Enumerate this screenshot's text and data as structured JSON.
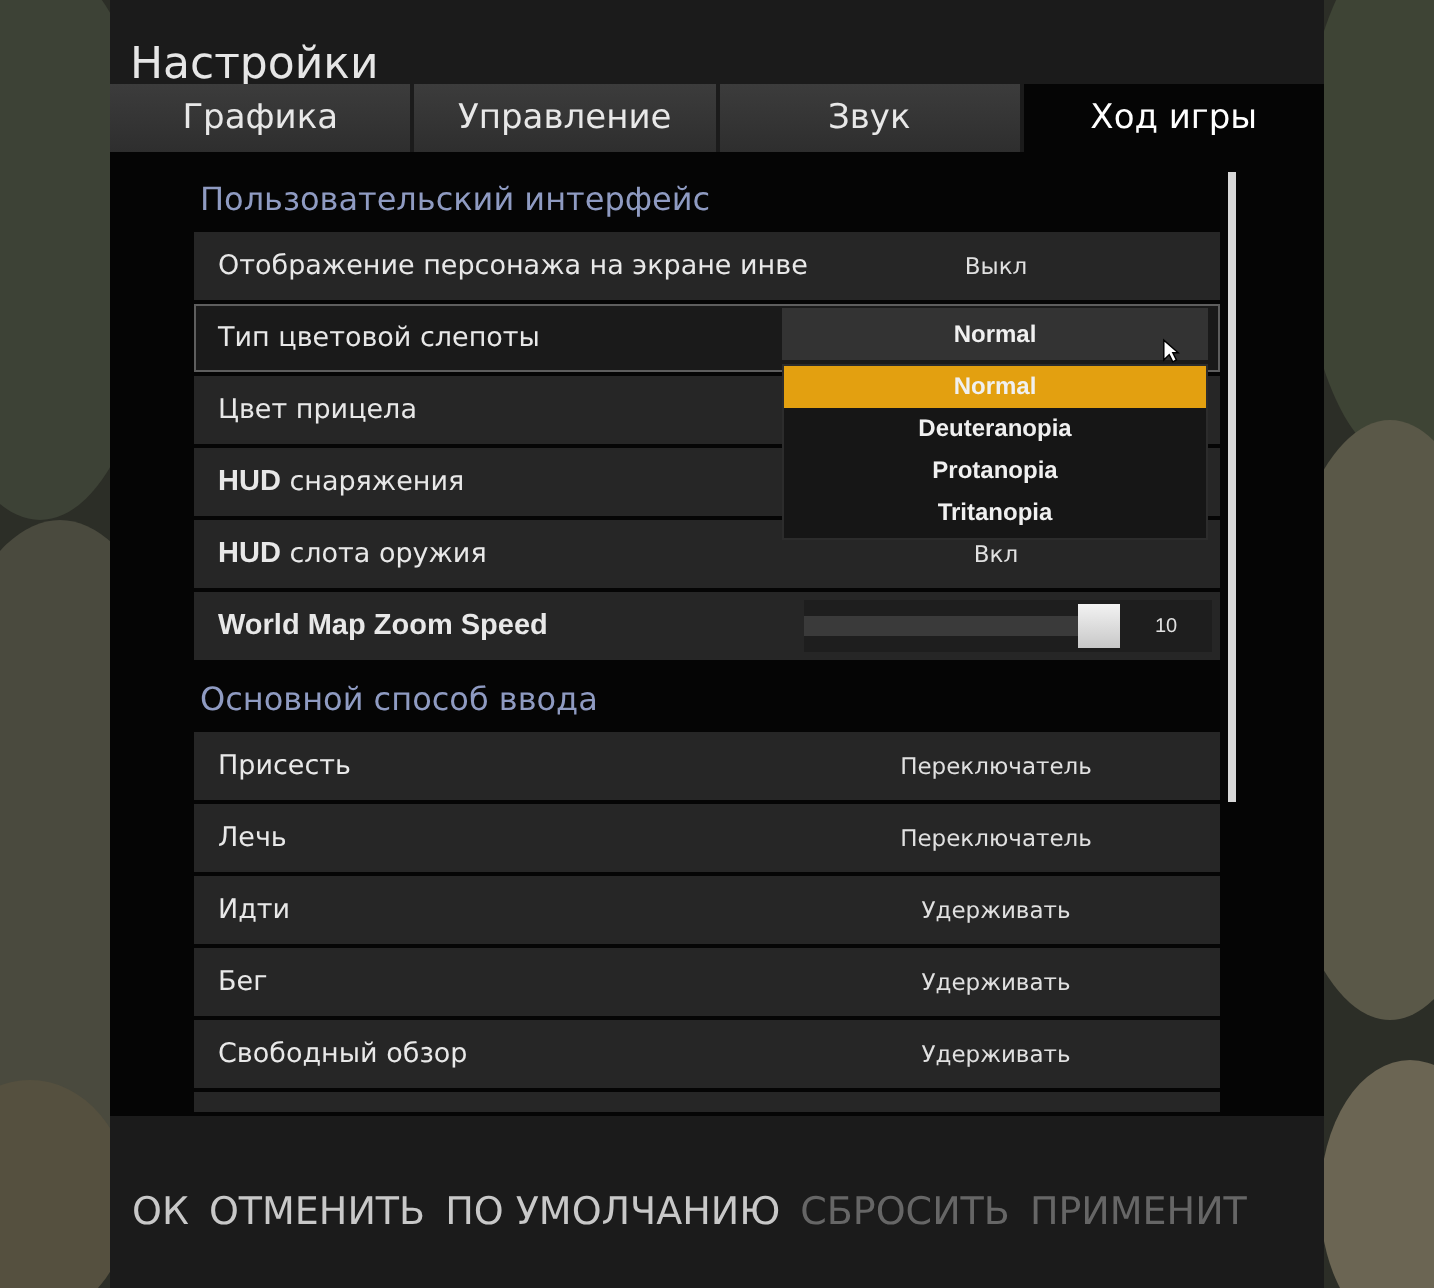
{
  "window": {
    "title": "Настройки"
  },
  "tabs": [
    {
      "label": "Графика",
      "selected": false
    },
    {
      "label": "Управление",
      "selected": false
    },
    {
      "label": "Звук",
      "selected": false
    },
    {
      "label": "Ход игры",
      "selected": true
    }
  ],
  "sections": [
    {
      "heading": "Пользовательский интерфейс",
      "rows": [
        {
          "kind": "value",
          "label": "Отображение персонажа на экране инве",
          "value": "Выкл"
        },
        {
          "kind": "dropdown",
          "label": "Тип цветовой слепоты",
          "value": "Normal",
          "expanded": true,
          "options": [
            {
              "label": "Normal",
              "selected": true
            },
            {
              "label": "Deuteranopia",
              "selected": false
            },
            {
              "label": "Protanopia",
              "selected": false
            },
            {
              "label": "Tritanopia",
              "selected": false
            }
          ]
        },
        {
          "kind": "value",
          "label": "Цвет прицела"
        },
        {
          "kind": "value",
          "label": "**HUD** снаряжения"
        },
        {
          "kind": "value",
          "label": "**HUD** слота оружия",
          "value": "Вкл"
        },
        {
          "kind": "slider",
          "label": "World Map Zoom Speed",
          "level": 1,
          "value": "10"
        }
      ]
    },
    {
      "heading": "Основной способ ввода",
      "rows": [
        {
          "kind": "value",
          "label": "Присесть",
          "value": "Переключатель"
        },
        {
          "kind": "value",
          "label": "Лечь",
          "value": "Переключатель"
        },
        {
          "kind": "value",
          "label": "Идти",
          "value": "Удерживать"
        },
        {
          "kind": "value",
          "label": "Бег",
          "value": "Удерживать"
        },
        {
          "kind": "value",
          "label": "Свободный обзор",
          "value": "Удерживать"
        }
      ]
    }
  ],
  "buttons": [
    {
      "label": "ОК",
      "disabled": false
    },
    {
      "label": "ОТМЕНИТЬ",
      "disabled": false
    },
    {
      "label": "ПО УМОЛЧАНИЮ",
      "disabled": false
    },
    {
      "label": "СБРОСИТЬ",
      "disabled": true
    },
    {
      "label": "ПРИМЕНИТ",
      "disabled": true
    }
  ]
}
